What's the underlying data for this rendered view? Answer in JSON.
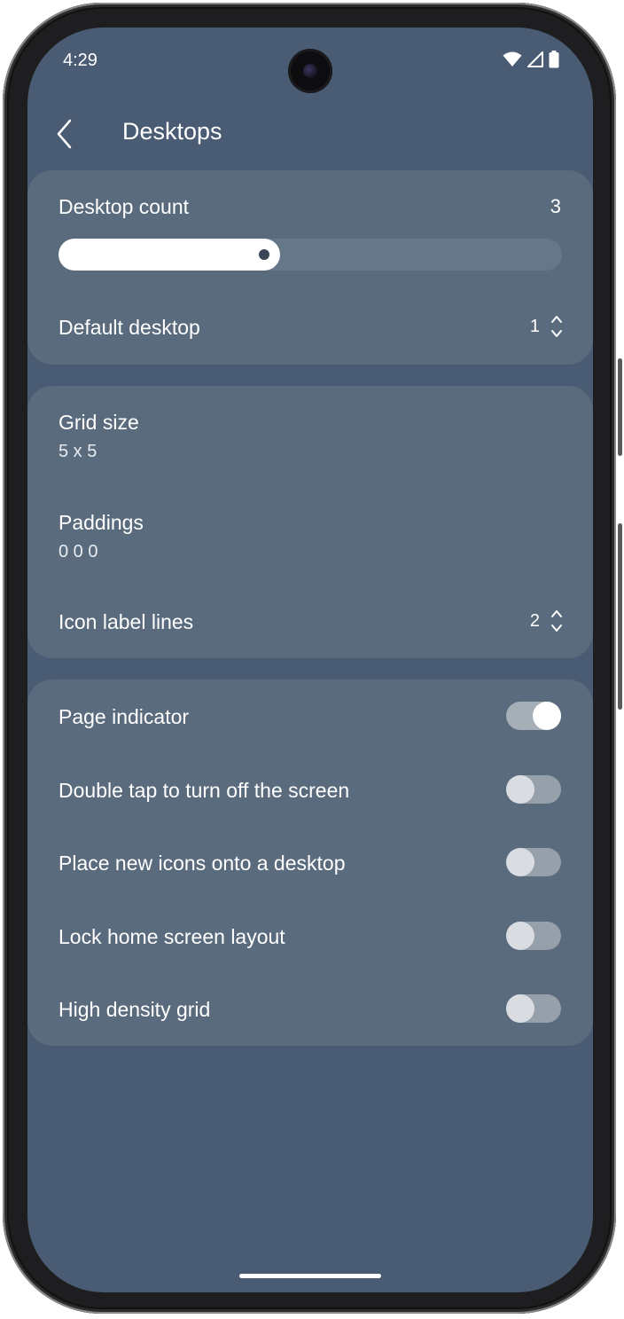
{
  "status_bar": {
    "time": "4:29",
    "icons": [
      "wifi-icon",
      "cellular-signal-icon",
      "battery-icon"
    ]
  },
  "header": {
    "back_icon": "chevron-left-icon",
    "title": "Desktops"
  },
  "desktops_card": {
    "desktop_count_label": "Desktop count",
    "desktop_count_value": "3",
    "slider_fraction": 0.44,
    "default_desktop_label": "Default desktop",
    "default_desktop_value": "1"
  },
  "grid_card": {
    "grid_size_label": "Grid size",
    "grid_size_value": "5 x 5",
    "paddings_label": "Paddings",
    "paddings_value": "0 0 0",
    "icon_label_lines_label": "Icon label lines",
    "icon_label_lines_value": "2"
  },
  "toggles": [
    {
      "label": "Page indicator",
      "on": true
    },
    {
      "label": "Double tap to turn off the screen",
      "on": false
    },
    {
      "label": "Place new icons onto a desktop",
      "on": false
    },
    {
      "label": "Lock home screen layout",
      "on": false
    },
    {
      "label": "High density grid",
      "on": false
    }
  ],
  "colors": {
    "background": "#4a5c73",
    "card": "#5a6b7d",
    "slider_track": "#67778a",
    "slider_fill": "#ffffff"
  }
}
